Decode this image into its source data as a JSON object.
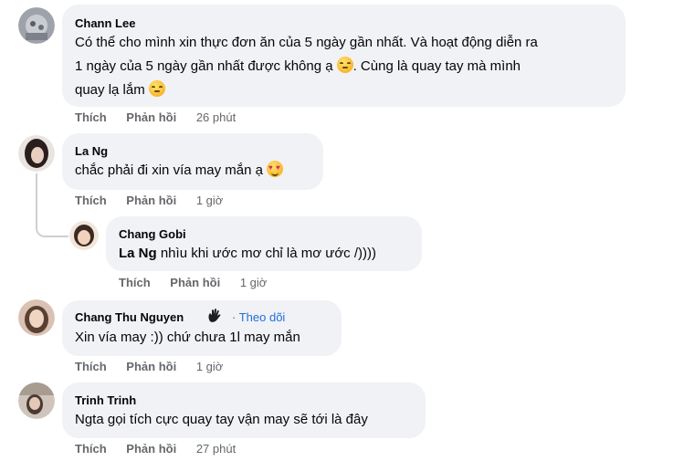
{
  "comments": [
    {
      "author": "Chann Lee",
      "lines": [
        "Có thể cho mình xin thực đơn ăn của 5 ngày gần nhất. Và hoạt động diễn ra",
        "1 ngày của 5 ngày gần nhất được không ạ",
        ". Cùng là quay tay mà mình",
        "quay lạ lắm"
      ],
      "like": "Thích",
      "reply": "Phản hồi",
      "time": "26 phút",
      "avatar_color": "#8a8f99"
    },
    {
      "author": "La Ng",
      "text": "chắc phải đi xin vía may mắn ạ",
      "like": "Thích",
      "reply": "Phản hồi",
      "time": "1 giờ",
      "avatar_color": "#3b2a2a"
    },
    {
      "author": "Chang Gobi",
      "mention": "La Ng",
      "text": " nhìu khi ước mơ chỉ là mơ ước /))))",
      "like": "Thích",
      "reply": "Phản hồi",
      "time": "1 giờ",
      "avatar_color": "#d7b08c"
    },
    {
      "author": "Chang Thu Nguyen",
      "follow_separator": "·",
      "follow": "Theo dõi",
      "text": "Xin vía may :)) chứ chưa 1l may mắn",
      "like": "Thích",
      "reply": "Phản hồi",
      "time": "1 giờ",
      "avatar_color": "#c9a48f"
    },
    {
      "author": "Trinh Trinh",
      "text": "Ngta gọi tích cực quay tay vận may sẽ tới là đây",
      "like": "Thích",
      "reply": "Phản hồi",
      "time": "27 phút",
      "avatar_color": "#b8aaa0"
    }
  ],
  "icons": {
    "emoji_relieved": "relieved-face-emoji",
    "emoji_heart_eyes": "heart-eyes-emoji",
    "fan_badge": "waving-hand-badge-icon"
  }
}
